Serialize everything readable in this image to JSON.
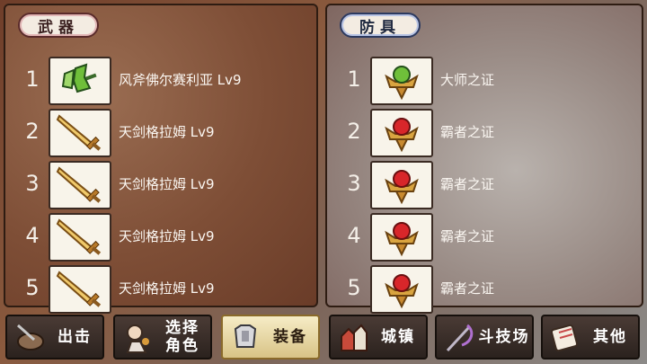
{
  "weapons": {
    "title": "武器",
    "items": [
      {
        "index": "1",
        "name": "风斧佛尔赛利亚 Lv9",
        "icon": "green-axe-icon"
      },
      {
        "index": "2",
        "name": "天剑格拉姆 Lv9",
        "icon": "gold-sword-icon"
      },
      {
        "index": "3",
        "name": "天剑格拉姆 Lv9",
        "icon": "gold-sword-icon"
      },
      {
        "index": "4",
        "name": "天剑格拉姆 Lv9",
        "icon": "gold-sword-icon"
      },
      {
        "index": "5",
        "name": "天剑格拉姆 Lv9",
        "icon": "gold-sword-icon"
      }
    ]
  },
  "armor": {
    "title": "防具",
    "items": [
      {
        "index": "1",
        "name": "大师之证",
        "icon": "green-gem-emblem-icon"
      },
      {
        "index": "2",
        "name": "霸者之证",
        "icon": "red-gem-emblem-icon"
      },
      {
        "index": "3",
        "name": "霸者之证",
        "icon": "red-gem-emblem-icon"
      },
      {
        "index": "4",
        "name": "霸者之证",
        "icon": "red-gem-emblem-icon"
      },
      {
        "index": "5",
        "name": "霸者之证",
        "icon": "red-gem-emblem-icon"
      }
    ]
  },
  "nav": {
    "sortie": "出击",
    "select_line1": "选择",
    "select_line2": "角色",
    "equip": "装备",
    "town": "城镇",
    "arena": "斗技场",
    "other": "其他"
  },
  "colors": {
    "gem_green": "#6fbf3a",
    "gem_red": "#d8262a",
    "gold": "#d9a440",
    "active_nav": "#f6ecc6"
  }
}
